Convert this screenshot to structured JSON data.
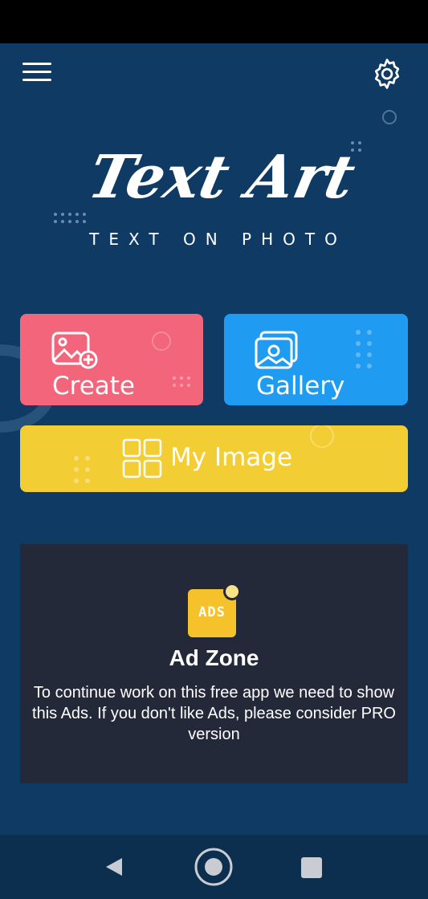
{
  "app": {
    "logo_text": "Text Art",
    "subtitle": "TEXT ON PHOTO"
  },
  "toolbar": {
    "menu_icon": "hamburger-menu-icon",
    "settings_icon": "gear-icon"
  },
  "actions": {
    "create_label": "Create",
    "gallery_label": "Gallery",
    "my_image_label": "My Image"
  },
  "ad": {
    "badge": "ADS",
    "title": "Ad Zone",
    "text": "To continue work on this free app we need to show this Ads. If you don't like Ads, please consider PRO version"
  },
  "nav": {
    "back_icon": "back-triangle-icon",
    "home_icon": "home-circle-icon",
    "recents_icon": "recents-square-icon"
  },
  "colors": {
    "background": "#0f3a63",
    "create": "#f2657a",
    "gallery": "#1f9bf2",
    "my_image": "#f2cd34",
    "ad_zone": "#24293a"
  }
}
